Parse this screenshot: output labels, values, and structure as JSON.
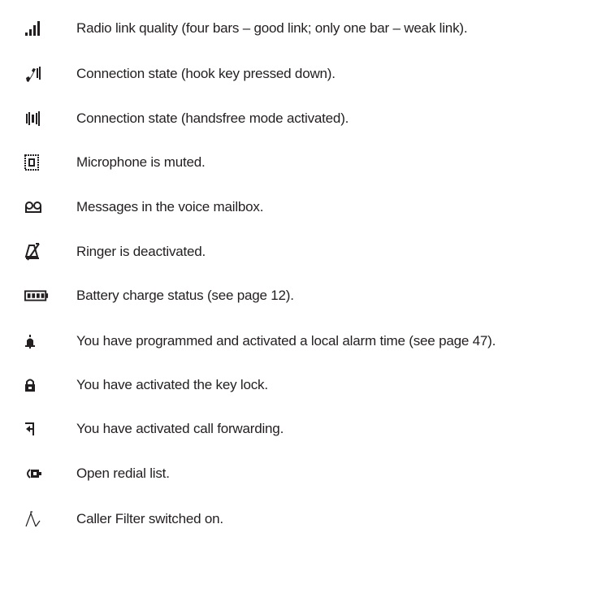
{
  "icons": {
    "items": [
      {
        "icon": "signal-bars-icon",
        "text": "Radio link quality (four bars – good link; only one bar – weak link)."
      },
      {
        "icon": "handset-hook-icon",
        "text": "Connection state (hook key pressed down)."
      },
      {
        "icon": "handsfree-icon",
        "text": "Connection state (handsfree mode activated)."
      },
      {
        "icon": "mute-microphone-icon",
        "text": "Microphone is muted."
      },
      {
        "icon": "voicemail-icon",
        "text": "Messages in the voice mailbox."
      },
      {
        "icon": "ringer-off-icon",
        "text": "Ringer is deactivated."
      },
      {
        "icon": "battery-icon",
        "text": "Battery charge status (see page 12)."
      },
      {
        "icon": "alarm-icon",
        "text": "You have programmed and activated a local alarm time (see page 47)."
      },
      {
        "icon": "key-lock-icon",
        "text": "You have activated the key lock."
      },
      {
        "icon": "call-forwarding-icon",
        "text": "You have activated call forwarding."
      },
      {
        "icon": "redial-list-icon",
        "text": "Open redial list."
      },
      {
        "icon": "caller-filter-icon",
        "text": "Caller Filter switched on."
      }
    ]
  }
}
